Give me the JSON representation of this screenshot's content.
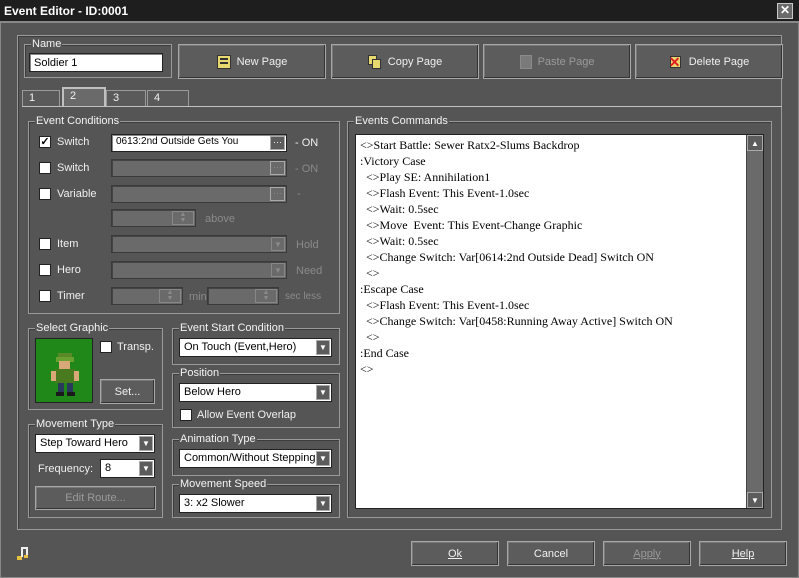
{
  "window": {
    "title": "Event Editor - ID:0001"
  },
  "name": {
    "label": "Name",
    "value": "Soldier 1"
  },
  "page_buttons": {
    "new_page": "New Page",
    "copy_page": "Copy Page",
    "paste_page": "Paste Page",
    "delete_page": "Delete Page"
  },
  "tabs": [
    {
      "label": "1"
    },
    {
      "label": "2"
    },
    {
      "label": "3"
    },
    {
      "label": "4"
    }
  ],
  "event_conditions": {
    "label": "Event Conditions",
    "switch1": {
      "label": "Switch",
      "checked": true,
      "value": "0613:2nd Outside Gets You",
      "suffix": "- ON"
    },
    "switch2": {
      "label": "Switch",
      "checked": false,
      "suffix": "- ON"
    },
    "variable": {
      "label": "Variable",
      "checked": false,
      "suffix": "-",
      "above": "above"
    },
    "item": {
      "label": "Item",
      "checked": false,
      "suffix": "Hold"
    },
    "hero": {
      "label": "Hero",
      "checked": false,
      "suffix": "Need"
    },
    "timer": {
      "label": "Timer",
      "checked": false,
      "min": "min",
      "sec": "sec less"
    }
  },
  "select_graphic": {
    "label": "Select Graphic",
    "transp": "Transp.",
    "set": "Set..."
  },
  "event_start": {
    "label": "Event Start Condition",
    "value": "On Touch (Event,Hero)"
  },
  "position": {
    "label": "Position",
    "value": "Below Hero",
    "overlap": "Allow Event Overlap"
  },
  "movement_type": {
    "label": "Movement Type",
    "value": "Step Toward Hero",
    "frequency_label": "Frequency:",
    "frequency": "8",
    "edit_route": "Edit Route..."
  },
  "animation_type": {
    "label": "Animation Type",
    "value": "Common/Without Stepping"
  },
  "movement_speed": {
    "label": "Movement Speed",
    "value": "3: x2 Slower"
  },
  "commands": {
    "label": "Events Commands",
    "lines": [
      "<>Start Battle: Sewer Ratx2-Slums Backdrop",
      ":Victory Case",
      "  <>Play SE: Annihilation1",
      "  <>Flash Event: This Event-1.0sec",
      "  <>Wait: 0.5sec",
      "  <>Move  Event: This Event-Change Graphic",
      "  <>Wait: 0.5sec",
      "  <>Change Switch: Var[0614:2nd Outside Dead] Switch ON",
      "  <>",
      ":Escape Case",
      "  <>Flash Event: This Event-1.0sec",
      "  <>Change Switch: Var[0458:Running Away Active] Switch ON",
      "  <>",
      ":End Case",
      "<>"
    ]
  },
  "footer": {
    "ok": "Ok",
    "cancel": "Cancel",
    "apply": "Apply",
    "help": "Help"
  },
  "icons": [
    "music-note-icon",
    "new-page-icon",
    "copy-page-icon",
    "paste-page-icon",
    "delete-page-icon",
    "close-icon"
  ]
}
